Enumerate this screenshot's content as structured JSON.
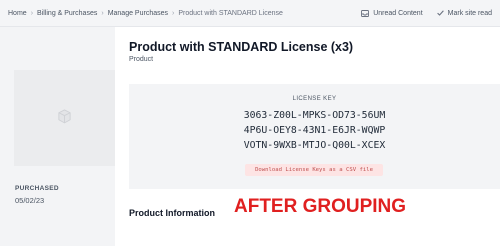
{
  "breadcrumbs": [
    "Home",
    "Billing & Purchases",
    "Manage Purchases",
    "Product with STANDARD License"
  ],
  "actions": {
    "unread": {
      "label": "Unread Content",
      "icon": "inbox-icon"
    },
    "mark_read": {
      "label": "Mark site read",
      "icon": "check-icon"
    }
  },
  "product": {
    "title": "Product with STANDARD License (x3)",
    "type": "Product",
    "thumbnail_icon": "box-icon"
  },
  "purchase": {
    "label": "PURCHASED",
    "date": "05/02/23"
  },
  "license": {
    "label": "LICENSE KEY",
    "keys": [
      "3063-Z00L-MPKS-OD73-56UM",
      "4P6U-OEY8-43N1-E6JR-WQWP",
      "VOTN-9WXB-MTJO-Q00L-XCEX"
    ],
    "download_label": "Download License Keys as a CSV file"
  },
  "sections": {
    "product_information": "Product Information"
  },
  "annotation": {
    "text": "AFTER GROUPING",
    "color": "#e02020"
  },
  "colors": {
    "panel_bg": "#f3f4f6",
    "download_bg": "#fde4e4",
    "download_text": "#c05050"
  }
}
